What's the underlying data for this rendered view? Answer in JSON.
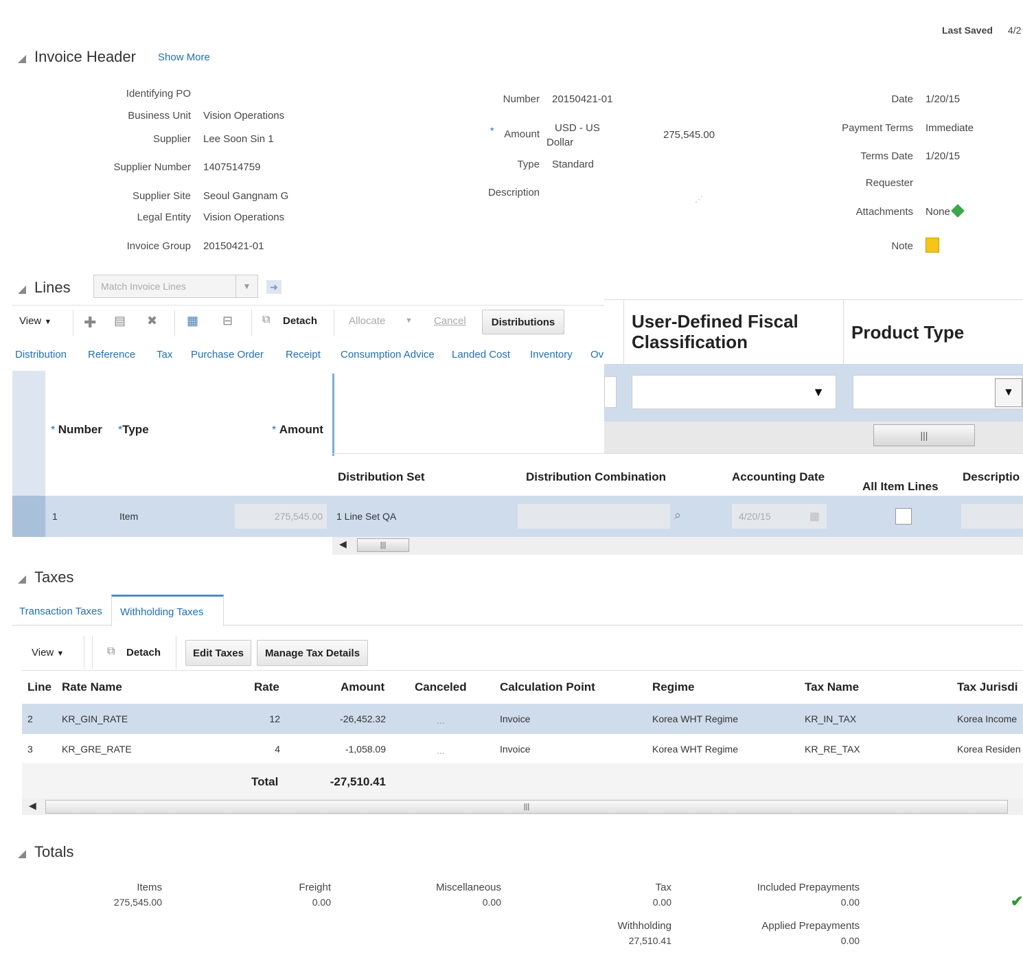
{
  "header": {
    "last_saved_label": "Last Saved",
    "last_saved_value": "4/2",
    "title": "Invoice Header",
    "show_more": "Show More",
    "left": [
      {
        "label": "Identifying PO",
        "value": ""
      },
      {
        "label": "Business Unit",
        "value": "Vision Operations"
      },
      {
        "label": "Supplier",
        "value": "Lee Soon Sin 1"
      },
      {
        "label": "Supplier Number",
        "value": "1407514759"
      },
      {
        "label": "Supplier Site",
        "value": "Seoul Gangnam G"
      },
      {
        "label": "Legal Entity",
        "value": "Vision Operations"
      },
      {
        "label": "Invoice Group",
        "value": "20150421-01"
      }
    ],
    "number_label": "Number",
    "number_value": "20150421-01",
    "amount_label": "Amount",
    "amount_currency_1": "USD - US",
    "amount_currency_2": "Dollar",
    "amount_value": "275,545.00",
    "type_label": "Type",
    "type_value": "Standard",
    "description_label": "Description",
    "date_label": "Date",
    "date_value": "1/20/15",
    "payment_terms_label": "Payment Terms",
    "payment_terms_value": "Immediate",
    "terms_date_label": "Terms Date",
    "terms_date_value": "1/20/15",
    "requester_label": "Requester",
    "attachments_label": "Attachments",
    "attachments_value": "None",
    "note_label": "Note"
  },
  "lines": {
    "title": "Lines",
    "match_placeholder": "Match Invoice Lines",
    "toolbar": {
      "view": "View",
      "detach": "Detach",
      "allocate": "Allocate",
      "cancel": "Cancel",
      "distributions": "Distributions"
    },
    "tabs": [
      "Distribution",
      "Reference",
      "Tax",
      "Purchase Order",
      "Receipt",
      "Consumption Advice",
      "Landed Cost",
      "Inventory",
      "Ov"
    ],
    "zoom_headers": {
      "fiscal_1": "User-Defined Fiscal",
      "fiscal_2": "Classification",
      "product_type": "Product Type"
    },
    "col_headers": {
      "number": "Number",
      "type": "Type",
      "amount": "Amount",
      "distribution_set": "Distribution Set",
      "distribution_combination": "Distribution Combination",
      "accounting_date": "Accounting Date",
      "all_item_lines": "All Item Lines",
      "description": "Descriptio"
    },
    "row": {
      "number": "1",
      "type": "Item",
      "amount": "275,545.00",
      "distribution_set": "1 Line Set QA",
      "accounting_date": "4/20/15"
    }
  },
  "taxes": {
    "title": "Taxes",
    "tabs": [
      "Transaction Taxes",
      "Withholding Taxes"
    ],
    "toolbar": {
      "view": "View",
      "detach": "Detach",
      "edit_taxes": "Edit Taxes",
      "manage_tax_details": "Manage Tax Details"
    },
    "columns": [
      "Line",
      "Rate Name",
      "Rate",
      "Amount",
      "Canceled",
      "Calculation Point",
      "Regime",
      "Tax Name",
      "Tax Jurisdi"
    ],
    "rows": [
      {
        "line": "2",
        "rate_name": "KR_GIN_RATE",
        "rate": "12",
        "amount": "-26,452.32",
        "canceled": "",
        "calc_point": "Invoice",
        "regime": "Korea WHT Regime",
        "tax_name": "KR_IN_TAX",
        "jurisdiction": "Korea Income"
      },
      {
        "line": "3",
        "rate_name": "KR_GRE_RATE",
        "rate": "4",
        "amount": "-1,058.09",
        "canceled": "",
        "calc_point": "Invoice",
        "regime": "Korea WHT Regime",
        "tax_name": "KR_RE_TAX",
        "jurisdiction": "Korea Residen"
      }
    ],
    "total_label": "Total",
    "total_value": "-27,510.41"
  },
  "totals": {
    "title": "Totals",
    "items_label": "Items",
    "items_value": "275,545.00",
    "freight_label": "Freight",
    "freight_value": "0.00",
    "misc_label": "Miscellaneous",
    "misc_value": "0.00",
    "tax_label": "Tax",
    "tax_value": "0.00",
    "withholding_label": "Withholding",
    "withholding_value": "27,510.41",
    "included_prepayments_label": "Included Prepayments",
    "included_prepayments_value": "0.00",
    "applied_prepayments_label": "Applied Prepayments",
    "applied_prepayments_value": "0.00"
  },
  "colors": {
    "link": "#1f6fb5",
    "selected_row": "#cfdcec",
    "note_icon": "#f5c518",
    "check": "#2e9a2e"
  }
}
